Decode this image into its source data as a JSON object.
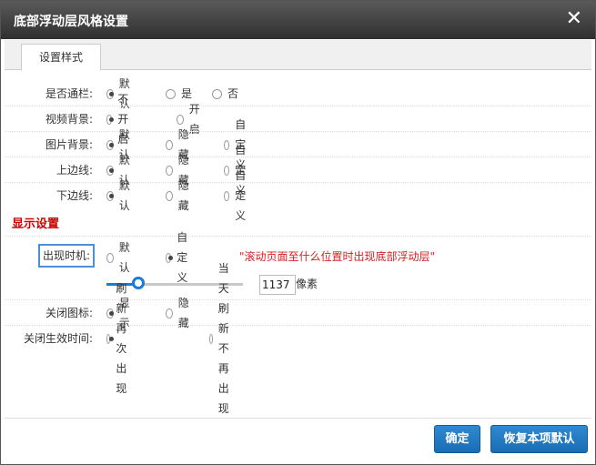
{
  "dialog": {
    "title": "底部浮动层风格设置",
    "close_glyph": "✕"
  },
  "tabs": [
    {
      "label": "设置样式"
    }
  ],
  "rows": [
    {
      "label": "是否通栏:",
      "options": [
        {
          "label": "默认",
          "checked": true
        },
        {
          "label": "是",
          "checked": false
        },
        {
          "label": "否",
          "checked": false
        }
      ]
    },
    {
      "label": "视频背景:",
      "options": [
        {
          "label": "不开启",
          "checked": true
        },
        {
          "label": "开启",
          "checked": false
        }
      ]
    },
    {
      "label": "图片背景:",
      "options": [
        {
          "label": "默认",
          "checked": true
        },
        {
          "label": "隐藏",
          "checked": false
        },
        {
          "label": "自定义",
          "checked": false
        }
      ]
    },
    {
      "label": "上边线:",
      "options": [
        {
          "label": "默认",
          "checked": true
        },
        {
          "label": "隐藏",
          "checked": false
        },
        {
          "label": "自定义",
          "checked": false
        }
      ]
    },
    {
      "label": "下边线:",
      "options": [
        {
          "label": "默认",
          "checked": true
        },
        {
          "label": "隐藏",
          "checked": false
        },
        {
          "label": "自定义",
          "checked": false
        }
      ]
    }
  ],
  "display": {
    "section_title": "显示设置",
    "timing": {
      "label": "出现时机:",
      "options": [
        {
          "label": "默认",
          "checked": false
        },
        {
          "label": "自定义",
          "checked": true
        }
      ],
      "hint": "\"滚动页面至什么位置时出现底部浮动层\"",
      "value": "1137",
      "unit": "像素",
      "slider_fraction": 0.23
    },
    "close_icon": {
      "label": "关闭图标:",
      "options": [
        {
          "label": "显示",
          "checked": true
        },
        {
          "label": "隐藏",
          "checked": false
        }
      ]
    },
    "close_effect": {
      "label": "关闭生效时间:",
      "options": [
        {
          "label": "刷新再次出现",
          "checked": true
        },
        {
          "label": "当天刷新不再出现",
          "checked": false
        }
      ]
    }
  },
  "buttons": {
    "confirm": "确定",
    "restore": "恢复本项默认"
  },
  "colors": {
    "accent": "#1a7bd8",
    "section_title": "#cc0000",
    "hint": "#d42020"
  }
}
